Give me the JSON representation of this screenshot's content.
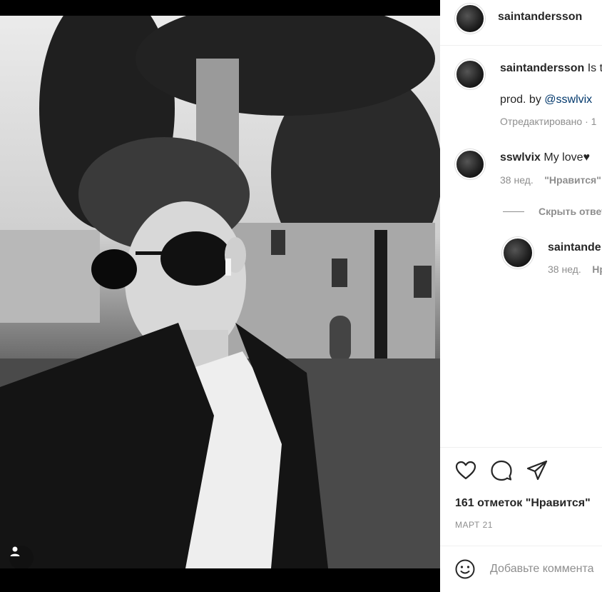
{
  "post": {
    "author": "saintandersson",
    "caption_author": "saintandersson",
    "caption_text": "Is t",
    "credit_prefix": "prod. by",
    "credit_mention": "@sswlvix",
    "edited_meta": "Отредактировано · 1"
  },
  "comments": [
    {
      "author": "sswlvix",
      "text": "My love♥",
      "time": "38 нед.",
      "likes_label": "\"Нравится\":",
      "hide_replies": "Скрыть ответ"
    }
  ],
  "reply": {
    "author": "saintande",
    "time": "38 нед.",
    "likes_label": "Нр"
  },
  "actions": {
    "like_icon": "heart-icon",
    "comment_icon": "comment-icon",
    "share_icon": "share-icon"
  },
  "likes": "161 отметок \"Нравится\"",
  "date": "МАРТ 21",
  "add_comment": {
    "placeholder": "Добавьте коммента",
    "emoji_icon": "emoji-icon"
  },
  "photo": {
    "user_tag_icon": "user-icon"
  },
  "colors": {
    "link": "#00376b",
    "meta": "#8e8e8e",
    "text": "#262626"
  }
}
